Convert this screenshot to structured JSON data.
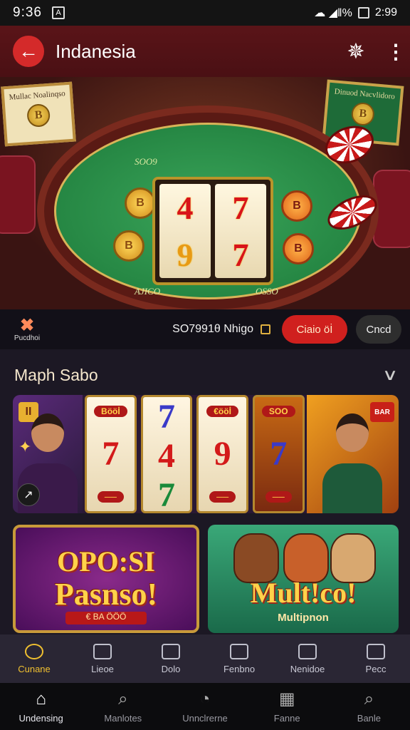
{
  "status_bar": {
    "time": "9:36",
    "battery": "2:99",
    "signal": "☁ ◢‖%"
  },
  "app_bar": {
    "title": "Indanesia",
    "back_icon": "←",
    "spark_icon": "✵",
    "more_icon": "⋮"
  },
  "hero": {
    "frame_left_text": "Mullac Noalinqso",
    "frame_right_text": "Dinuod Nacvlidoro",
    "felt_text_top": "SOO9",
    "felt_text_bottom_left": "AJICO",
    "felt_text_bottom_right": "OSSO",
    "reels": [
      [
        "4",
        "9"
      ],
      [
        "7",
        "7"
      ]
    ]
  },
  "promo": {
    "brand_name": "Pucdhoi",
    "code_text": "SO7991θ Nhigo",
    "claim_label": "Ciaio öİ",
    "cancel_label": "Cncd"
  },
  "section": {
    "title": "Maph Sabo"
  },
  "row1": {
    "slot_tags": [
      "Bööİ",
      "€ööİ",
      "SOO"
    ],
    "slot_cols": [
      [
        "7",
        "7"
      ],
      [
        "4",
        "7"
      ],
      [
        "9",
        ""
      ],
      [
        "7",
        ""
      ]
    ]
  },
  "banners": {
    "b1_line1": "OPO:SI",
    "b1_line2": "Pasnso!",
    "b1_small": "€ BA ÖÖÖ",
    "b2_title": "Mult!co!",
    "b2_sub": "Multipnon"
  },
  "tabs": [
    {
      "label": "Cunane",
      "active": true
    },
    {
      "label": "Lieoe",
      "active": false
    },
    {
      "label": "Dolo",
      "active": false
    },
    {
      "label": "Fenbno",
      "active": false
    },
    {
      "label": "Nenidoe",
      "active": false
    },
    {
      "label": "Pecc",
      "active": false
    }
  ],
  "nav": [
    {
      "label": "Undensing",
      "icon": "⌂",
      "active": true
    },
    {
      "label": "Manlotes",
      "icon": "⌕",
      "active": false
    },
    {
      "label": "Unnclrerne",
      "icon": "◔",
      "active": false
    },
    {
      "label": "Fanne",
      "icon": "▦",
      "active": false
    },
    {
      "label": "Banle",
      "icon": "⌕",
      "active": false
    }
  ],
  "colors": {
    "accent_red": "#d0201e",
    "tab_active": "#f0c030",
    "app_bar": "#5a1418"
  }
}
